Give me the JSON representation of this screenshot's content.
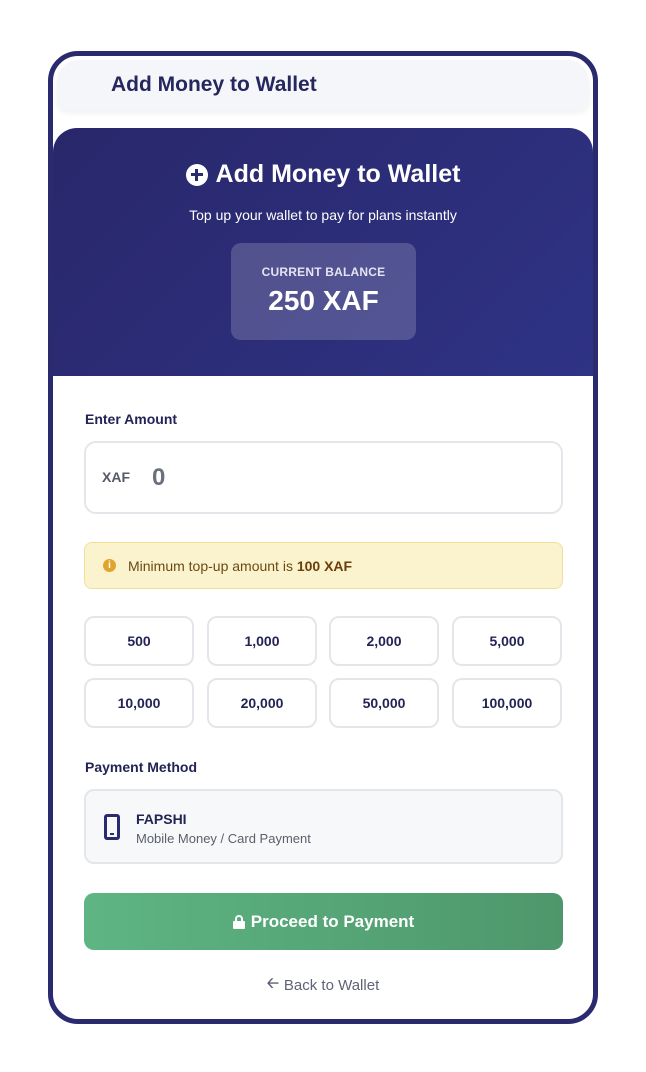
{
  "header": {
    "title": "Add Money to Wallet"
  },
  "hero": {
    "title": "Add Money to Wallet",
    "subtitle": "Top up your wallet to pay for plans instantly",
    "balance_label": "CURRENT BALANCE",
    "balance_value": "250 XAF"
  },
  "amount": {
    "label": "Enter Amount",
    "currency": "XAF",
    "value": "0"
  },
  "notice": {
    "text": "Minimum top-up amount is ",
    "strong": "100 XAF"
  },
  "presets": [
    "500",
    "1,000",
    "2,000",
    "5,000",
    "10,000",
    "20,000",
    "50,000",
    "100,000"
  ],
  "payment": {
    "label": "Payment Method",
    "name": "FAPSHI",
    "description": "Mobile Money / Card Payment"
  },
  "actions": {
    "proceed": "Proceed to Payment",
    "back": "Back to Wallet"
  },
  "icons": {
    "hero": "plus-circle-icon",
    "notice": "info-icon",
    "payment": "mobile-phone-icon",
    "proceed": "lock-icon",
    "back": "arrow-left-icon"
  },
  "colors": {
    "brand": "#2a2a6e",
    "success": "#5eb583",
    "notice_bg": "#fbf3cd"
  }
}
